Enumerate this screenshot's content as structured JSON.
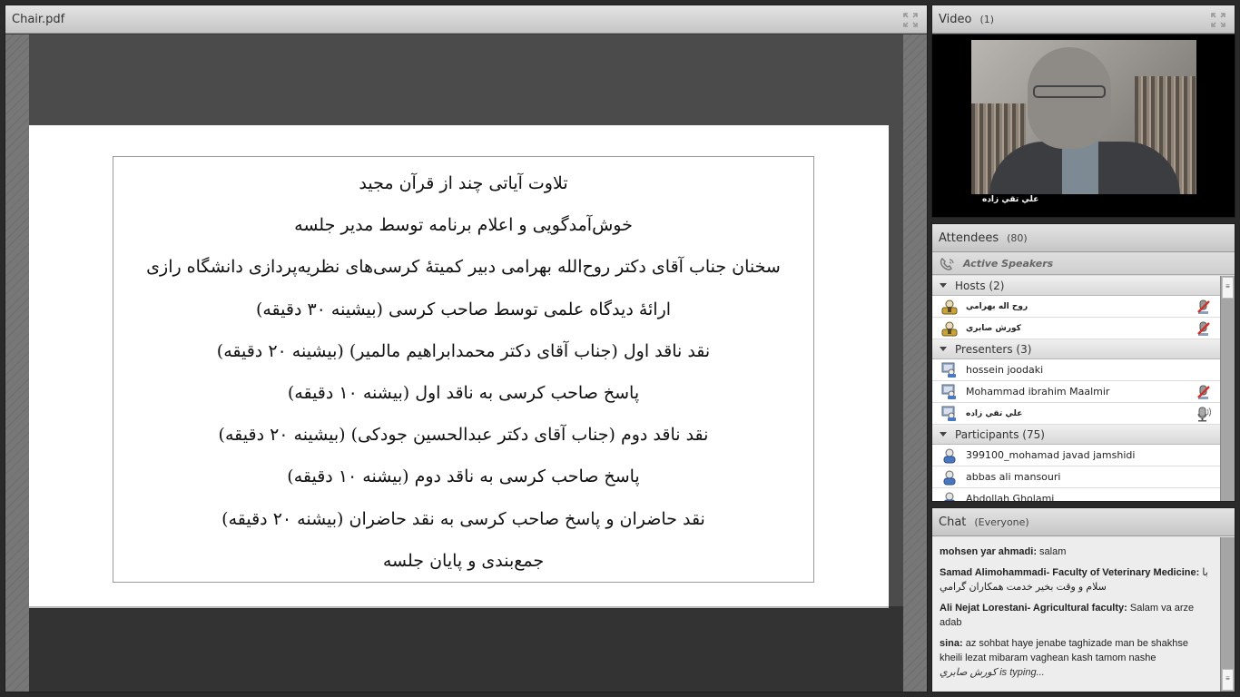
{
  "share": {
    "title": "Chair.pdf",
    "slide_lines": [
      "تلاوت آیاتی چند از قرآن مجید",
      "خوش‌آمدگویی و اعلام برنامه توسط مدیر جلسه",
      "سخنان جناب آقای دکتر روح‌الله بهرامی دبیر کمیتهٔ کرسی‌های نظریه‌پردازی دانشگاه رازی",
      "ارائهٔ دیدگاه علمی توسط صاحب کرسی (بیشینه ۳۰ دقیقه)",
      "نقد ناقد اول (جناب آقای دکتر محمدابراهیم مالمیر) (بیشینه ۲۰ دقیقه)",
      "پاسخ صاحب کرسی به ناقد اول (بیشنه ۱۰ دقیقه)",
      "نقد ناقد دوم (جناب آقای دکتر عبدالحسین جودکی) (بیشینه ۲۰ دقیقه)",
      "پاسخ صاحب کرسی به ناقد دوم (بیشنه ۱۰ دقیقه)",
      "نقد حاضران و پاسخ صاحب کرسی به نقد حاضران (بیشنه ۲۰ دقیقه)",
      "جمع‌بندی و پایان جلسه"
    ]
  },
  "video": {
    "title": "Video",
    "count": "(1)",
    "speaker_name": "علي تقي زاده"
  },
  "attendees": {
    "title": "Attendees",
    "count": "(80)",
    "active_speakers_label": "Active Speakers",
    "groups": [
      {
        "label": "Hosts (2)",
        "members": [
          {
            "name": "روح اله بهرامي",
            "rtl": true,
            "mic": "muted"
          },
          {
            "name": "كورش صابري",
            "rtl": true,
            "mic": "muted"
          }
        ]
      },
      {
        "label": "Presenters (3)",
        "members": [
          {
            "name": "hossein joodaki",
            "rtl": false,
            "mic": "none"
          },
          {
            "name": "Mohammad  ibrahim Maalmir",
            "rtl": false,
            "mic": "muted"
          },
          {
            "name": "علي تقي زاده",
            "rtl": true,
            "mic": "speaking"
          }
        ]
      },
      {
        "label": "Participants (75)",
        "members": [
          {
            "name": "399100_mohamad javad jamshidi",
            "rtl": false,
            "mic": "none"
          },
          {
            "name": "abbas ali mansouri",
            "rtl": false,
            "mic": "none"
          },
          {
            "name": "Abdollah Gholami",
            "rtl": false,
            "mic": "none"
          }
        ]
      }
    ]
  },
  "chat": {
    "title": "Chat",
    "audience": "(Everyone)",
    "messages": [
      {
        "sender": "mohsen yar ahmadi:",
        "text": "salam"
      },
      {
        "sender": "Samad Alimohammadi- Faculty of Veterinary Medicine:",
        "text": "با سلام و وقت بخير خدمت همكاران گرامي"
      },
      {
        "sender": "Ali Nejat Lorestani- Agricultural faculty:",
        "text": "Salam va arze adab"
      },
      {
        "sender": "sina:",
        "text": "az sohbat haye jenabe taghizade man be shakhse kheili lezat mibaram vaghean kash tamom nashe"
      }
    ],
    "typing_user": "كورش صابري",
    "typing_suffix": "is typing..."
  },
  "colors": {
    "muted_mic": "#d0302a",
    "host_icon": "#c9a43b",
    "participant_icon": "#4a78c0"
  }
}
